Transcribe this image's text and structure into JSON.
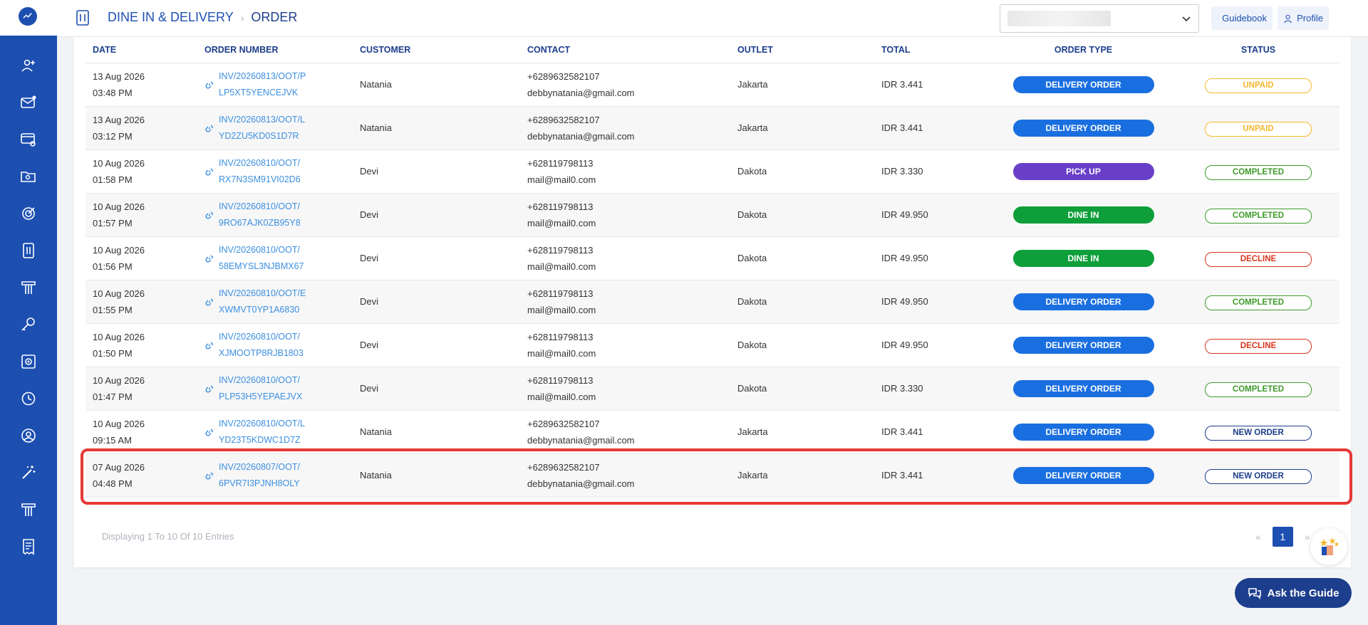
{
  "header": {
    "breadcrumb": [
      "DINE IN & DELIVERY",
      "ORDER"
    ],
    "breadcrumb_separator": "›",
    "guidebook_label": "Guidebook",
    "profile_label": "Profile"
  },
  "sidebar": {
    "items": [
      {
        "icon": "customer-add-icon"
      },
      {
        "icon": "mail-icon"
      },
      {
        "icon": "settings-card-icon"
      },
      {
        "icon": "folder-icon"
      },
      {
        "icon": "target-icon"
      },
      {
        "icon": "dine-icon"
      },
      {
        "icon": "stand-icon"
      },
      {
        "icon": "key-icon"
      },
      {
        "icon": "gear-book-icon"
      },
      {
        "icon": "history-icon"
      },
      {
        "icon": "user-settings-icon"
      },
      {
        "icon": "magic-wand-icon"
      },
      {
        "icon": "stand-icon"
      },
      {
        "icon": "receipt-icon"
      }
    ]
  },
  "table": {
    "columns": [
      "DATE",
      "ORDER NUMBER",
      "CUSTOMER",
      "CONTACT",
      "OUTLET",
      "TOTAL",
      "ORDER TYPE",
      "STATUS"
    ],
    "rows": [
      {
        "date": "13 Aug 2026",
        "time": "03:48 PM",
        "inv1": "INV/20260813/OOT/P",
        "inv2": "LP5XT5YENCEJVK",
        "customer": "Natania",
        "phone": "+6289632582107",
        "email": "debbynatania@gmail.com",
        "outlet": "Jakarta",
        "total": "IDR 3.441",
        "type": "DELIVERY ORDER",
        "status": "UNPAID"
      },
      {
        "date": "13 Aug 2026",
        "time": "03:12 PM",
        "inv1": "INV/20260813/OOT/L",
        "inv2": "YD2ZU5KD0S1D7R",
        "customer": "Natania",
        "phone": "+6289632582107",
        "email": "debbynatania@gmail.com",
        "outlet": "Jakarta",
        "total": "IDR 3.441",
        "type": "DELIVERY ORDER",
        "status": "UNPAID"
      },
      {
        "date": "10 Aug 2026",
        "time": "01:58 PM",
        "inv1": "INV/20260810/OOT/",
        "inv2": "RX7N3SM91VI02D6",
        "customer": "Devi",
        "phone": "+628119798113",
        "email": "mail@mail0.com",
        "outlet": "Dakota",
        "total": "IDR 3.330",
        "type": "PICK UP",
        "status": "COMPLETED"
      },
      {
        "date": "10 Aug 2026",
        "time": "01:57 PM",
        "inv1": "INV/20260810/OOT/",
        "inv2": "9RO67AJK0ZB95Y8",
        "customer": "Devi",
        "phone": "+628119798113",
        "email": "mail@mail0.com",
        "outlet": "Dakota",
        "total": "IDR 49.950",
        "type": "DINE IN",
        "status": "COMPLETED"
      },
      {
        "date": "10 Aug 2026",
        "time": "01:56 PM",
        "inv1": "INV/20260810/OOT/",
        "inv2": "58EMYSL3NJBMX67",
        "customer": "Devi",
        "phone": "+628119798113",
        "email": "mail@mail0.com",
        "outlet": "Dakota",
        "total": "IDR 49.950",
        "type": "DINE IN",
        "status": "DECLINE"
      },
      {
        "date": "10 Aug 2026",
        "time": "01:55 PM",
        "inv1": "INV/20260810/OOT/E",
        "inv2": "XWMVT0YP1A6830",
        "customer": "Devi",
        "phone": "+628119798113",
        "email": "mail@mail0.com",
        "outlet": "Dakota",
        "total": "IDR 49.950",
        "type": "DELIVERY ORDER",
        "status": "COMPLETED"
      },
      {
        "date": "10 Aug 2026",
        "time": "01:50 PM",
        "inv1": "INV/20260810/OOT/",
        "inv2": "XJMOOTP8RJB1803",
        "customer": "Devi",
        "phone": "+628119798113",
        "email": "mail@mail0.com",
        "outlet": "Dakota",
        "total": "IDR 49.950",
        "type": "DELIVERY ORDER",
        "status": "DECLINE"
      },
      {
        "date": "10 Aug 2026",
        "time": "01:47 PM",
        "inv1": "INV/20260810/OOT/",
        "inv2": "PLP53H5YEPAEJVX",
        "customer": "Devi",
        "phone": "+628119798113",
        "email": "mail@mail0.com",
        "outlet": "Dakota",
        "total": "IDR 3.330",
        "type": "DELIVERY ORDER",
        "status": "COMPLETED"
      },
      {
        "date": "10 Aug 2026",
        "time": "09:15 AM",
        "inv1": "INV/20260810/OOT/L",
        "inv2": "YD23T5KDWC1D7Z",
        "customer": "Natania",
        "phone": "+6289632582107",
        "email": "debbynatania@gmail.com",
        "outlet": "Jakarta",
        "total": "IDR 3.441",
        "type": "DELIVERY ORDER",
        "status": "NEW ORDER"
      },
      {
        "date": "07 Aug 2026",
        "time": "04:48 PM",
        "inv1": "INV/20260807/OOT/",
        "inv2": "6PVR7I3PJNH8OLY",
        "customer": "Natania",
        "phone": "+6289632582107",
        "email": "debbynatania@gmail.com",
        "outlet": "Jakarta",
        "total": "IDR 3.441",
        "type": "DELIVERY ORDER",
        "status": "NEW ORDER"
      }
    ]
  },
  "type_colors": {
    "DELIVERY ORDER": "#1a6fe0",
    "PICK UP": "#6a3fc8",
    "DINE IN": "#0e9f3a"
  },
  "status_colors": {
    "UNPAID": "#f5b82e",
    "COMPLETED": "#3e9b2a",
    "DECLINE": "#d9341f",
    "NEW ORDER": "#1d3e8c"
  },
  "footer": {
    "entries_text": "Displaying 1 To 10 Of 10 Entries",
    "prev": "«",
    "page": "1",
    "next": "»"
  },
  "ask_label": "Ask the Guide"
}
